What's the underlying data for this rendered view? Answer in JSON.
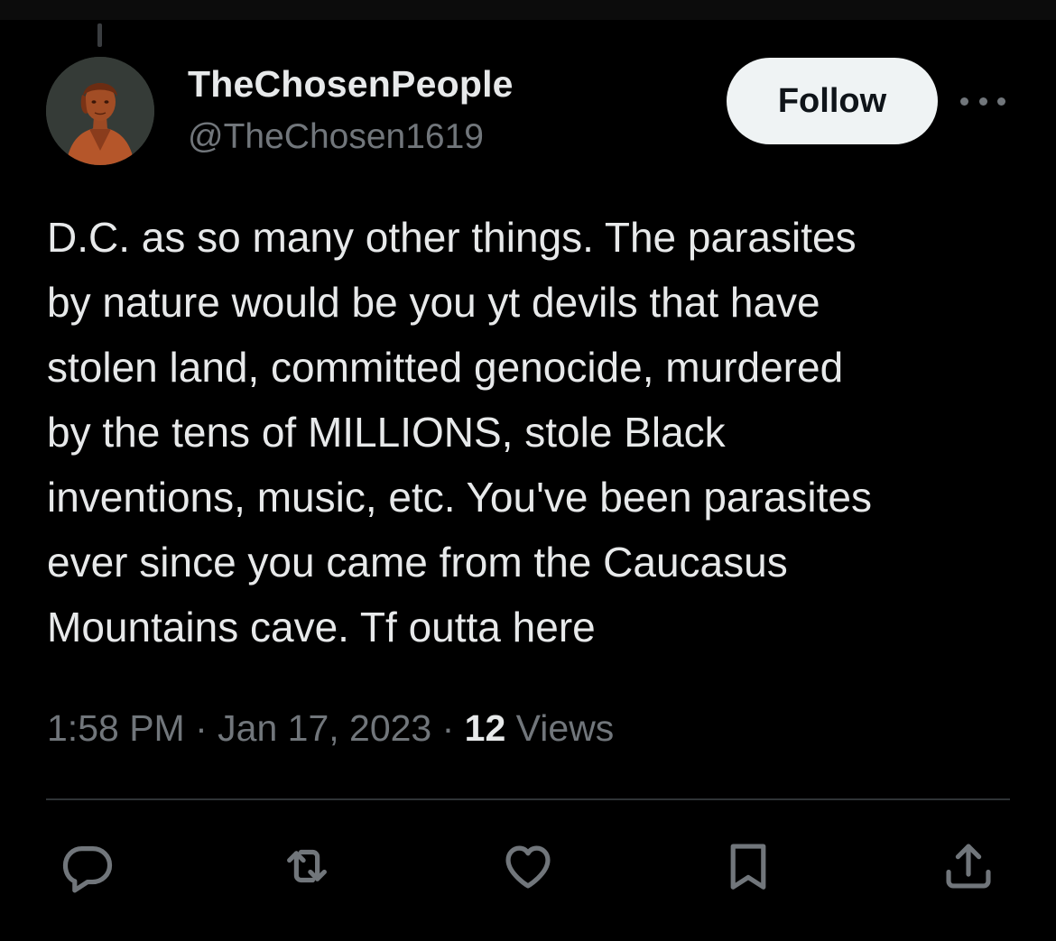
{
  "author": {
    "display_name": "TheChosenPeople",
    "handle": "@TheChosen1619"
  },
  "follow_button": {
    "label": "Follow"
  },
  "more_menu": {
    "icon": "more-horizontal-icon"
  },
  "tweet": {
    "lines": [
      "D.C. as so many other things. The parasites",
      "by nature would be you yt devils that have",
      "stolen land, committed genocide, murdered",
      "by the tens of MILLIONS, stole Black",
      "inventions, music, etc. You've been parasites",
      "ever since you came from the Caucasus",
      "Mountains cave. Tf outta here"
    ]
  },
  "meta": {
    "time": "1:58 PM",
    "separator": " · ",
    "date": "Jan 17, 2023",
    "views_count": "12",
    "views_label": " Views"
  },
  "actions": [
    {
      "name": "reply",
      "icon": "reply-icon"
    },
    {
      "name": "retweet",
      "icon": "retweet-icon"
    },
    {
      "name": "like",
      "icon": "heart-icon"
    },
    {
      "name": "bookmark",
      "icon": "bookmark-icon"
    },
    {
      "name": "share",
      "icon": "share-icon"
    }
  ],
  "colors": {
    "background": "#000000",
    "primary_text": "#e7e9ea",
    "secondary_text": "#71767b",
    "divider": "#2f3336",
    "follow_button_bg": "#eff3f4",
    "follow_button_text": "#0f1419"
  }
}
